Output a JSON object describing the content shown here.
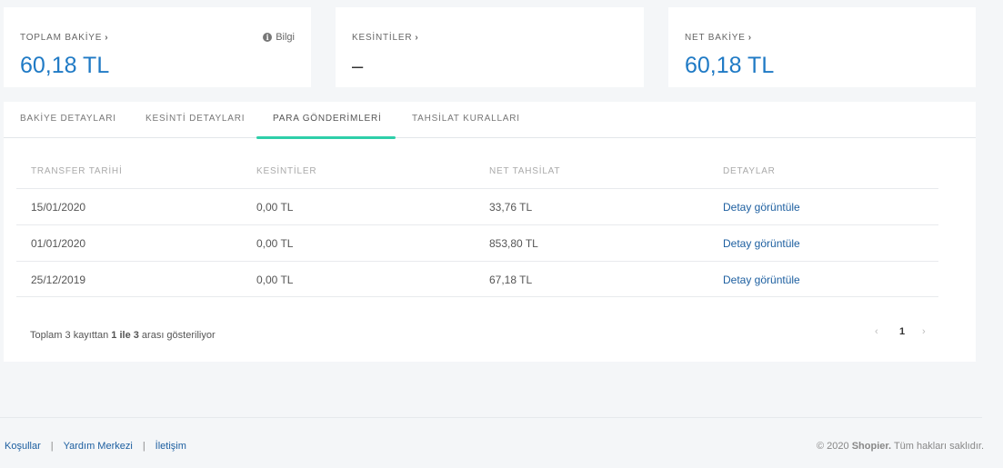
{
  "cards": {
    "total_balance": {
      "label": "TOPLAM BAKİYE",
      "value": "60,18 TL",
      "info_label": "Bilgi"
    },
    "deductions": {
      "label": "KESİNTİLER",
      "value": "–"
    },
    "net_balance": {
      "label": "NET BAKİYE",
      "value": "60,18 TL"
    }
  },
  "tabs": [
    {
      "label": "BAKİYE DETAYLARI"
    },
    {
      "label": "KESİNTİ DETAYLARI"
    },
    {
      "label": "PARA GÖNDERİMLERİ"
    },
    {
      "label": "TAHSİLAT KURALLARI"
    }
  ],
  "table": {
    "headers": [
      "TRANSFER TARİHİ",
      "KESİNTİLER",
      "NET TAHSİLAT",
      "DETAYLAR"
    ],
    "rows": [
      {
        "date": "15/01/2020",
        "deductions": "0,00 TL",
        "net": "33,76 TL",
        "detail": "Detay görüntüle"
      },
      {
        "date": "01/01/2020",
        "deductions": "0,00 TL",
        "net": "853,80 TL",
        "detail": "Detay görüntüle"
      },
      {
        "date": "25/12/2019",
        "deductions": "0,00 TL",
        "net": "67,18 TL",
        "detail": "Detay görüntüle"
      }
    ]
  },
  "summary": {
    "prefix": "Toplam 3 kayıttan ",
    "range": "1 ile 3",
    "suffix": " arası gösteriliyor"
  },
  "pagination": {
    "prev": "‹",
    "current": "1",
    "next": "›"
  },
  "footer": {
    "links": [
      "Koşullar",
      "Yardım Merkezi",
      "İletişim"
    ],
    "separator": "|",
    "copyright_prefix": "© 2020 ",
    "brand": "Shopier.",
    "copyright_suffix": " Tüm hakları saklıdır."
  }
}
